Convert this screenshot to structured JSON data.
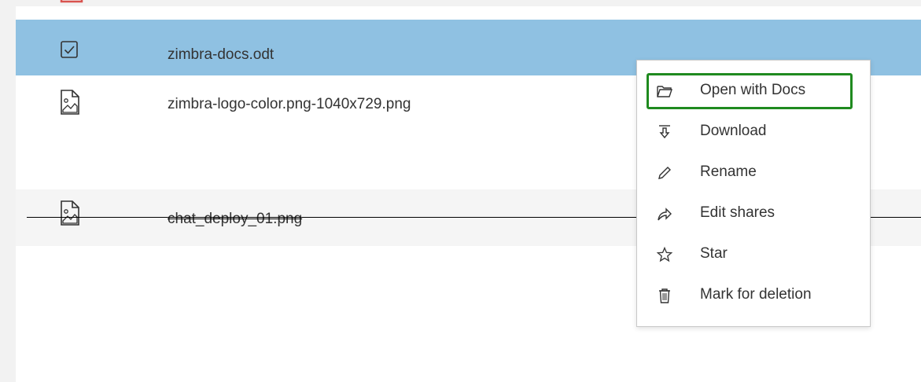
{
  "files": [
    {
      "name": "",
      "icon": "pdf-file-icon"
    },
    {
      "name": "zimbra-docs.odt",
      "icon": "checkbox-checked-icon",
      "selected": true
    },
    {
      "name": "zimbra-logo-color.png-1040x729.png",
      "icon": "image-file-icon"
    },
    {
      "name": "chat_deploy_01.png",
      "icon": "image-file-icon",
      "marked_for_deletion": true
    }
  ],
  "context_menu": {
    "items": [
      {
        "label": "Open with Docs",
        "icon": "folder-open-icon",
        "highlighted": true
      },
      {
        "label": "Download",
        "icon": "download-icon"
      },
      {
        "label": "Rename",
        "icon": "pencil-icon"
      },
      {
        "label": "Edit shares",
        "icon": "share-icon"
      },
      {
        "label": "Star",
        "icon": "star-icon"
      },
      {
        "label": "Mark for deletion",
        "icon": "trash-icon"
      }
    ]
  },
  "colors": {
    "selected_row": "#8fc1e2",
    "highlight_border": "#1f8a1f",
    "pdf_icon": "#d9534f"
  }
}
